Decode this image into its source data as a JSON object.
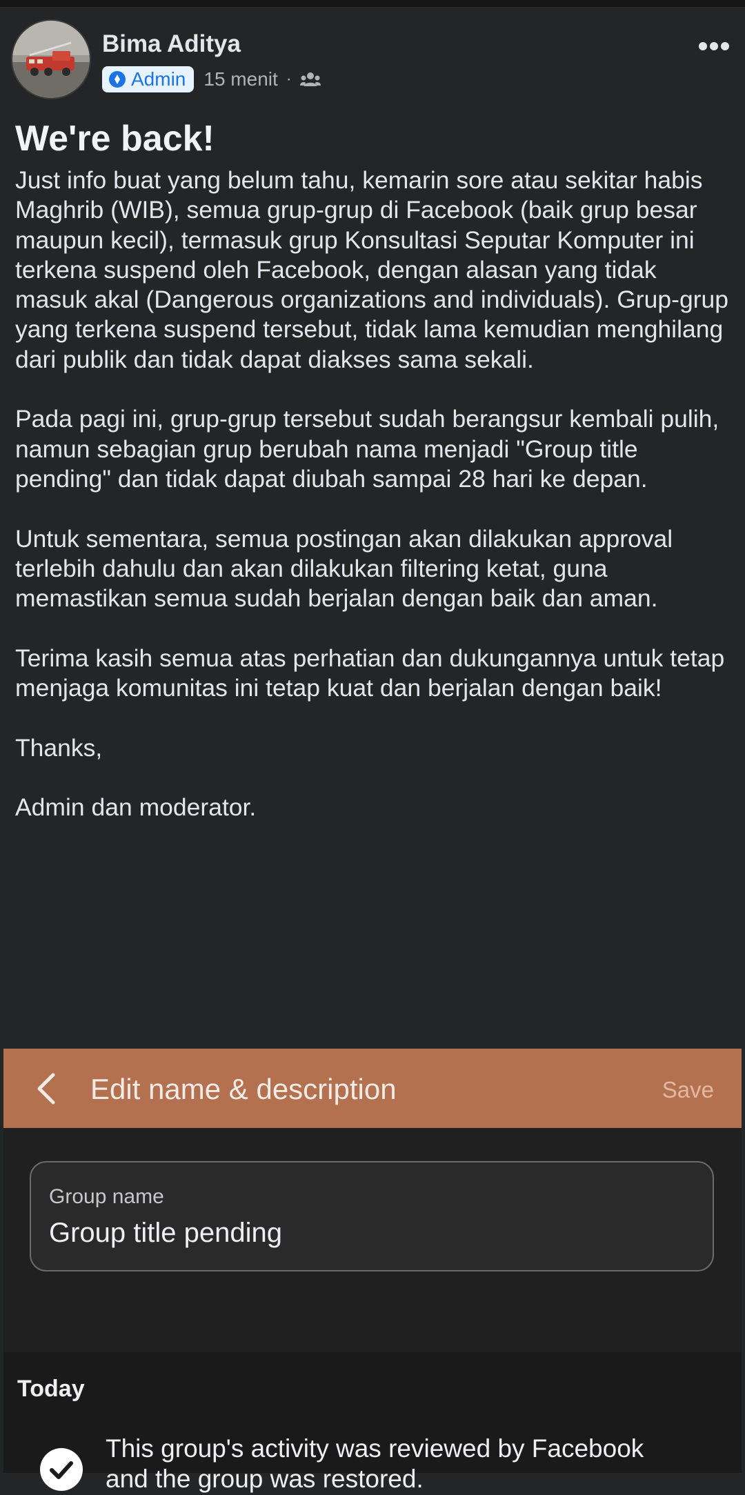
{
  "post": {
    "author": "Bima Aditya",
    "badge": "Admin",
    "timestamp": "15 menit",
    "separator": "·",
    "audience_icon": "group-members-icon",
    "title": "We're back!",
    "paragraphs": [
      "Just info buat yang belum tahu, kemarin sore atau sekitar habis Maghrib (WIB), semua grup-grup di Facebook (baik grup besar maupun kecil), termasuk grup Konsultasi Seputar Komputer ini terkena suspend oleh Facebook, dengan alasan yang tidak masuk akal (Dangerous organizations and individuals). Grup-grup yang terkena suspend tersebut, tidak lama kemudian menghilang dari publik dan tidak dapat diakses sama sekali.",
      "Pada pagi ini, grup-grup tersebut sudah berangsur kembali pulih, namun sebagian grup berubah nama menjadi \"Group title pending\" dan tidak dapat diubah sampai 28 hari ke depan.",
      "Untuk sementara, semua postingan akan dilakukan approval terlebih dahulu dan akan dilakukan filtering ketat, guna memastikan semua sudah berjalan dengan baik dan aman.",
      "Terima kasih semua atas perhatian dan dukungannya untuk tetap menjaga komunitas ini tetap kuat dan berjalan dengan baik!",
      "Thanks,",
      "Admin dan moderator."
    ]
  },
  "screenshot": {
    "header_title": "Edit name & description",
    "save_label": "Save",
    "field_label": "Group name",
    "field_value": "Group title pending",
    "section_label": "Today",
    "activity_line_1": "This group's activity was reviewed by Facebook",
    "activity_line_2": "and the group was restored."
  },
  "colors": {
    "background": "#242526",
    "badge_background": "#e7f3ff",
    "badge_text": "#1b74e4",
    "screenshot_header": "#b4714f"
  }
}
